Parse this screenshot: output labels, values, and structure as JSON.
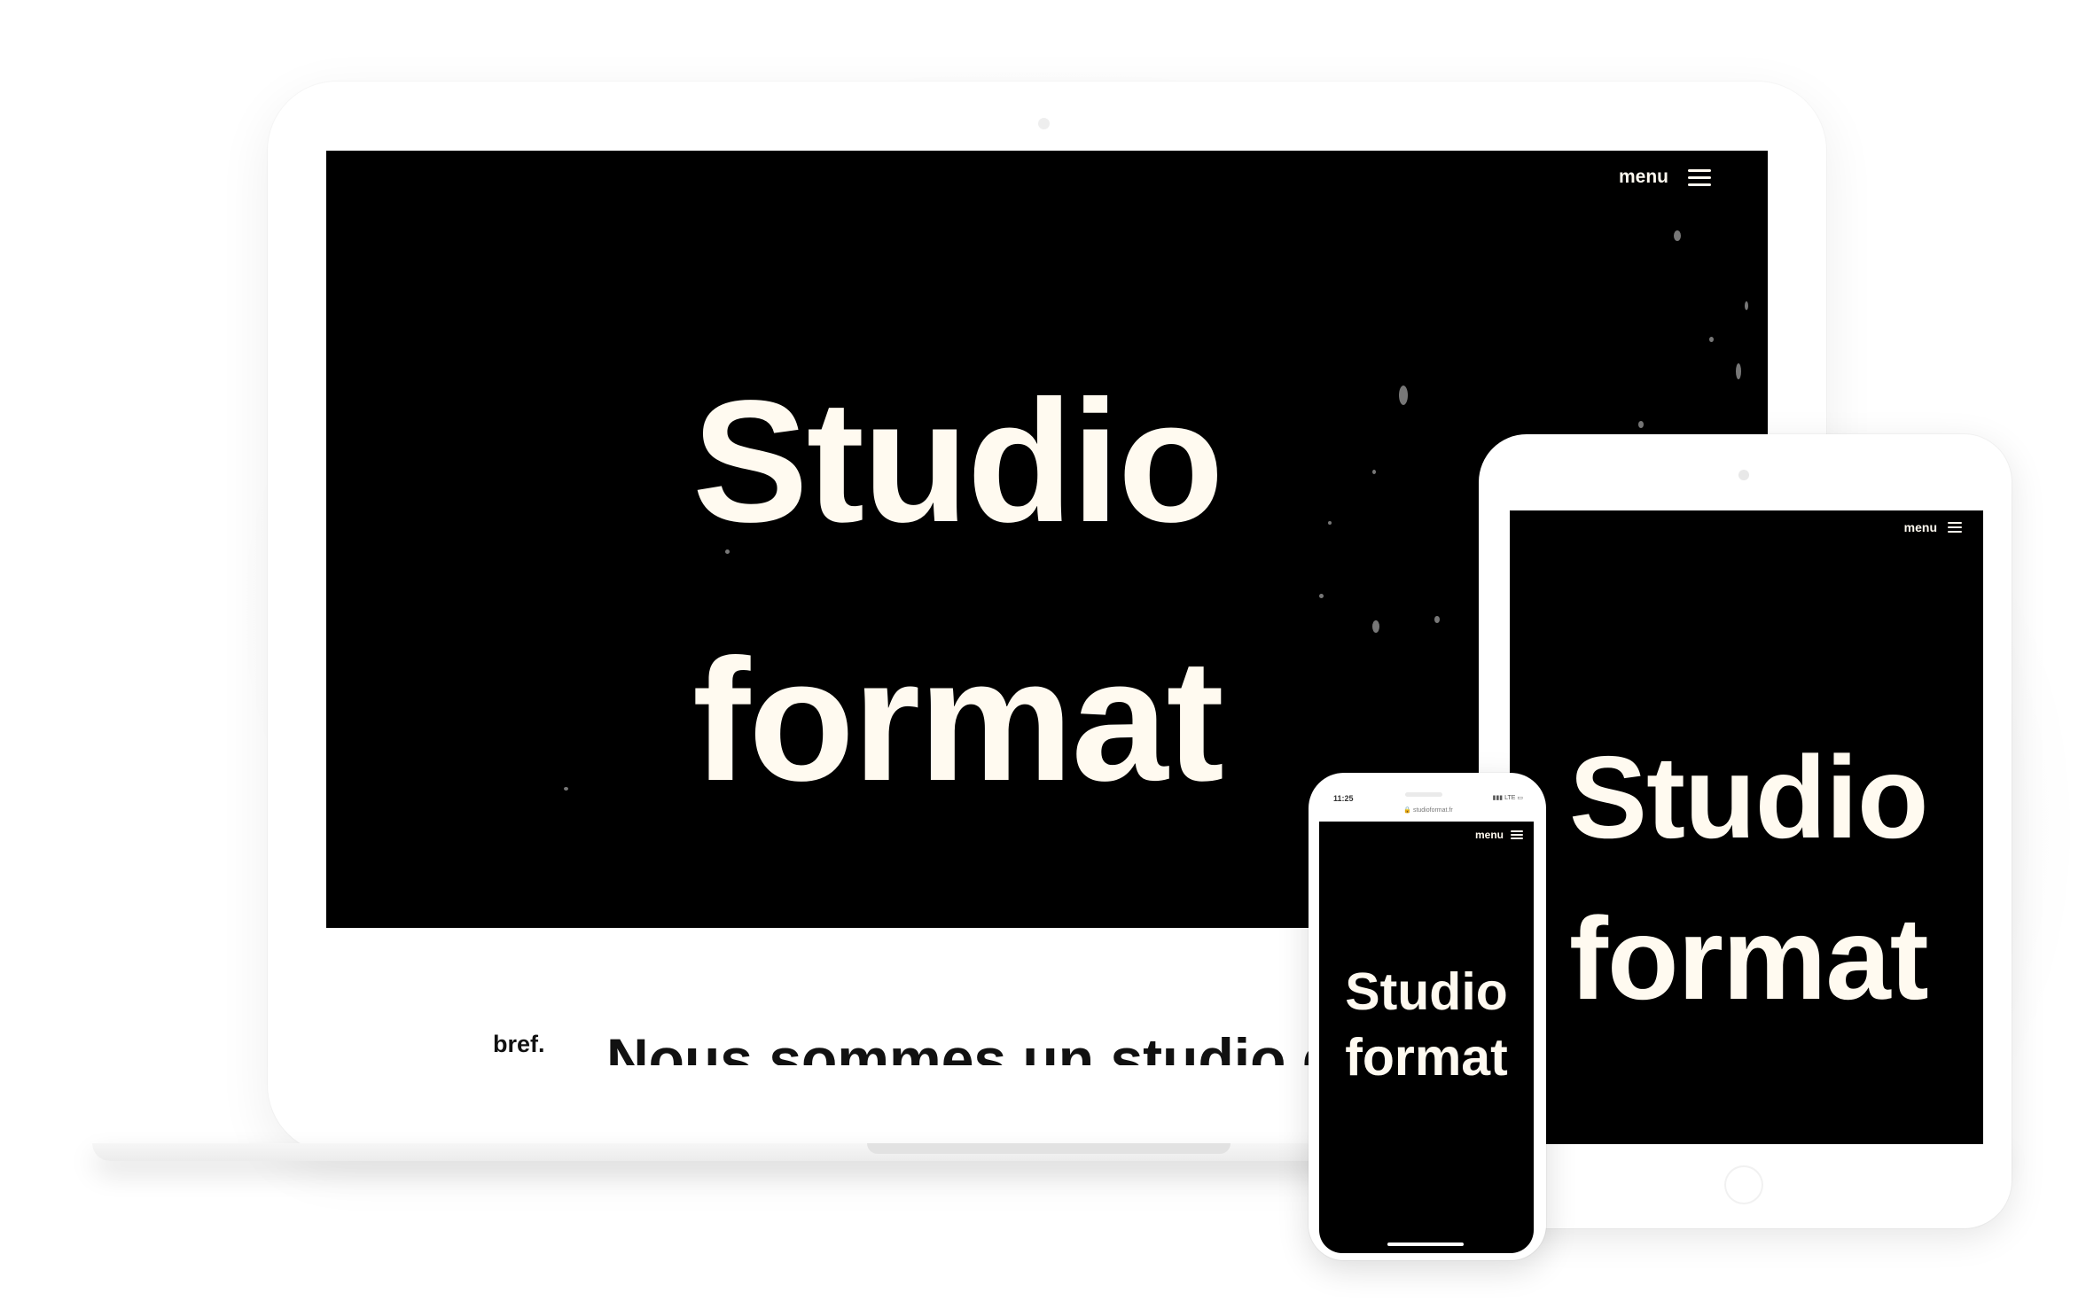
{
  "laptop": {
    "menu_label": "menu",
    "title_line1": "Studio",
    "title_line2": "format",
    "section_label": "bref.",
    "cutoff_heading": "Nous sommes un studio de création"
  },
  "tablet": {
    "menu_label": "menu",
    "title_line1": "Studio",
    "title_line2": "format"
  },
  "phone": {
    "time": "11:25",
    "status": "LTE",
    "url": "studioformat.fr",
    "menu_label": "menu",
    "title_line1": "Studio",
    "title_line2": "format"
  },
  "colors": {
    "screen_background": "#000000",
    "title_text": "#fffaf0",
    "device_body": "#ffffff"
  },
  "icons": [
    "hamburger-menu-icon",
    "lock-icon"
  ]
}
